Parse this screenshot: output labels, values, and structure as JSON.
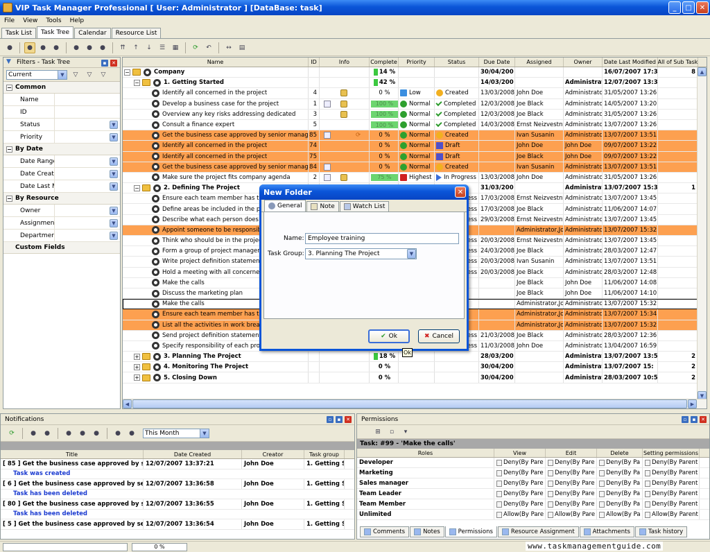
{
  "window": {
    "title": "VIP Task Manager Professional [ User: Administrator ] [DataBase: task]",
    "min": "_",
    "max": "□",
    "close": "✕"
  },
  "menu": [
    "File",
    "View",
    "Tools",
    "Help"
  ],
  "tabs": [
    "Task List",
    "Task Tree",
    "Calendar",
    "Resource List"
  ],
  "active_tab": "Task Tree",
  "filters": {
    "title": "Filters - Task Tree",
    "current": "Current",
    "sections": [
      {
        "name": "Common",
        "items": [
          "Name",
          "ID",
          "Status",
          "Priority"
        ]
      },
      {
        "name": "By Date",
        "items": [
          "Date Range",
          "Date Create",
          "Date Last Mo"
        ]
      },
      {
        "name": "By Resource",
        "items": [
          "Owner",
          "Assignment",
          "Department"
        ]
      },
      {
        "name": "Custom Fields",
        "items": []
      }
    ]
  },
  "grid": {
    "columns": [
      "Name",
      "ID",
      "Info",
      "Complete",
      "Priority",
      "Status",
      "Due Date",
      "Assigned",
      "Owner",
      "Date Last Modified",
      "All of Sub Task"
    ],
    "rows": [
      {
        "name": "Company",
        "id": "",
        "complete": "14 %",
        "pct": 0.14,
        "bar": true,
        "priority": "",
        "pkind": "",
        "status": "",
        "skind": "",
        "due": "30/04/200",
        "assigned": "",
        "owner": "",
        "modified": "16/07/2007 17:3",
        "sub": "8",
        "level": 0,
        "type": "group",
        "bold": true,
        "orange": false,
        "exp": "−"
      },
      {
        "name": "1. Getting Started",
        "id": "",
        "complete": "42 %",
        "pct": 0.42,
        "bar": true,
        "priority": "",
        "pkind": "",
        "status": "",
        "skind": "",
        "due": "14/03/200",
        "assigned": "",
        "owner": "Administrator",
        "modified": "12/07/2007 13:3",
        "sub": "",
        "level": 1,
        "type": "group",
        "bold": true,
        "orange": false,
        "exp": "−"
      },
      {
        "name": "Identify all concerned in the project",
        "id": "4",
        "complete": "0 %",
        "pct": 0,
        "bar": false,
        "priority": "Low",
        "pkind": "low",
        "status": "Created",
        "skind": "created",
        "due": "13/03/2008",
        "assigned": "John Doe",
        "owner": "Administrator",
        "modified": "31/05/2007 13:26",
        "sub": "",
        "level": 2,
        "type": "task",
        "bold": false,
        "orange": false,
        "lock": true
      },
      {
        "name": "Develop a business case for the project",
        "id": "1",
        "complete": "100 %",
        "pct": 1,
        "bar": true,
        "priority": "Normal",
        "pkind": "normal",
        "status": "Completed",
        "skind": "completed",
        "due": "12/03/2008",
        "assigned": "Joe Black",
        "owner": "Administrator",
        "modified": "14/05/2007 13:20",
        "sub": "",
        "level": 2,
        "type": "task",
        "bold": false,
        "orange": false,
        "lock": true,
        "attach": true
      },
      {
        "name": "Overview any key risks addressing dedicated",
        "id": "3",
        "complete": "100 %",
        "pct": 1,
        "bar": true,
        "priority": "Normal",
        "pkind": "normal",
        "status": "Completed",
        "skind": "completed",
        "due": "12/03/2008",
        "assigned": "Joe Black",
        "owner": "Administrator",
        "modified": "31/05/2007 13:26",
        "sub": "",
        "level": 2,
        "type": "task",
        "bold": false,
        "orange": false,
        "lock": true
      },
      {
        "name": "Consult a finance expert",
        "id": "5",
        "complete": "100 %",
        "pct": 1,
        "bar": true,
        "priority": "Normal",
        "pkind": "normal",
        "status": "Completed",
        "skind": "completed",
        "due": "14/03/2008",
        "assigned": "Ernst Neizvestny",
        "owner": "Administrator",
        "modified": "13/07/2007 13:26",
        "sub": "",
        "level": 2,
        "type": "task",
        "bold": false,
        "orange": false
      },
      {
        "name": "Get the business case approved by senior managers",
        "id": "85",
        "complete": "0 %",
        "pct": 0,
        "bar": false,
        "priority": "Normal",
        "pkind": "normal",
        "status": "Created",
        "skind": "created",
        "due": "",
        "assigned": "Ivan Susanin",
        "owner": "Administrator",
        "modified": "13/07/2007 13:51",
        "sub": "",
        "level": 2,
        "type": "task",
        "bold": false,
        "orange": true,
        "attach": true,
        "recur": true
      },
      {
        "name": "Identify all concerned in the project",
        "id": "74",
        "complete": "0 %",
        "pct": 0,
        "bar": false,
        "priority": "Normal",
        "pkind": "normal",
        "status": "Draft",
        "skind": "draft",
        "due": "",
        "assigned": "John Doe",
        "owner": "John Doe",
        "modified": "09/07/2007 13:22",
        "sub": "",
        "level": 2,
        "type": "task",
        "bold": false,
        "orange": true
      },
      {
        "name": "Identify all concerned in the project",
        "id": "75",
        "complete": "0 %",
        "pct": 0,
        "bar": false,
        "priority": "Normal",
        "pkind": "normal",
        "status": "Draft",
        "skind": "draft",
        "due": "",
        "assigned": "Joe Black",
        "owner": "John Doe",
        "modified": "09/07/2007 13:22",
        "sub": "",
        "level": 2,
        "type": "task",
        "bold": false,
        "orange": true
      },
      {
        "name": "Get the business case approved by senior managers",
        "id": "84",
        "complete": "0 %",
        "pct": 0,
        "bar": false,
        "priority": "Normal",
        "pkind": "normal",
        "status": "Created",
        "skind": "created",
        "due": "",
        "assigned": "Ivan Susanin",
        "owner": "Administrator",
        "modified": "13/07/2007 13:51",
        "sub": "",
        "level": 2,
        "type": "task",
        "bold": false,
        "orange": true,
        "attach": true
      },
      {
        "name": "Make sure the project fits company agenda",
        "id": "2",
        "complete": "75 %",
        "pct": 0.75,
        "bar": true,
        "priority": "Highest",
        "pkind": "high",
        "status": "In Progress",
        "skind": "progress",
        "due": "13/03/2008",
        "assigned": "John Doe",
        "owner": "Administrator",
        "modified": "31/05/2007 13:26",
        "sub": "",
        "level": 2,
        "type": "task",
        "bold": false,
        "orange": false,
        "lock": true,
        "attach": true
      },
      {
        "name": "2. Defining The Project",
        "id": "",
        "complete": "",
        "pct": 0,
        "bar": false,
        "priority": "",
        "pkind": "",
        "status": "",
        "skind": "",
        "due": "31/03/200",
        "assigned": "",
        "owner": "Administrator",
        "modified": "13/07/2007 15:3",
        "sub": "1",
        "level": 1,
        "type": "group",
        "bold": true,
        "orange": false,
        "exp": "−"
      },
      {
        "name": "Ensure each team member has the",
        "id": "",
        "complete": "",
        "pct": 0,
        "bar": false,
        "priority": "",
        "pkind": "",
        "status": "ess",
        "skind": "",
        "due": "17/03/2008",
        "assigned": "Ernst Neizvestny",
        "owner": "Administrator",
        "modified": "13/07/2007 13:45",
        "sub": "",
        "level": 2,
        "type": "task",
        "bold": false,
        "orange": false
      },
      {
        "name": "Define areas be included in the proj",
        "id": "",
        "complete": "",
        "pct": 0,
        "bar": false,
        "priority": "",
        "pkind": "",
        "status": "ess",
        "skind": "",
        "due": "17/03/2008",
        "assigned": "Joe Black",
        "owner": "Administrator",
        "modified": "11/06/2007 14:07",
        "sub": "",
        "level": 2,
        "type": "task",
        "bold": false,
        "orange": false
      },
      {
        "name": "Describe what each person does in",
        "id": "",
        "complete": "",
        "pct": 0,
        "bar": false,
        "priority": "",
        "pkind": "",
        "status": "ess",
        "skind": "",
        "due": "29/03/2008",
        "assigned": "Ernst Neizvestny",
        "owner": "Administrator",
        "modified": "13/07/2007 13:45",
        "sub": "",
        "level": 2,
        "type": "task",
        "bold": false,
        "orange": false
      },
      {
        "name": "Appoint someone to be responsible",
        "id": "",
        "complete": "",
        "pct": 0,
        "bar": false,
        "priority": "",
        "pkind": "",
        "status": "",
        "skind": "",
        "due": "",
        "assigned": "Administrator,Joh",
        "owner": "Administrator",
        "modified": "13/07/2007 15:32",
        "sub": "",
        "level": 2,
        "type": "task",
        "bold": false,
        "orange": true
      },
      {
        "name": "Think who should be in the project t",
        "id": "",
        "complete": "",
        "pct": 0,
        "bar": false,
        "priority": "",
        "pkind": "",
        "status": "ess",
        "skind": "",
        "due": "20/03/2008",
        "assigned": "Ernst Neizvestny",
        "owner": "Administrator",
        "modified": "13/07/2007 13:45",
        "sub": "",
        "level": 2,
        "type": "task",
        "bold": false,
        "orange": false
      },
      {
        "name": "Form a group of project managers",
        "id": "",
        "complete": "",
        "pct": 0,
        "bar": false,
        "priority": "",
        "pkind": "",
        "status": "ess",
        "skind": "",
        "due": "24/03/2008",
        "assigned": "Joe Black",
        "owner": "Administrator",
        "modified": "28/03/2007 12:47",
        "sub": "",
        "level": 2,
        "type": "task",
        "bold": false,
        "orange": false
      },
      {
        "name": "Write project definition statement",
        "id": "",
        "complete": "",
        "pct": 0,
        "bar": false,
        "priority": "",
        "pkind": "",
        "status": "ess",
        "skind": "",
        "due": "20/03/2008",
        "assigned": "Ivan Susanin",
        "owner": "Administrator",
        "modified": "13/07/2007 13:51",
        "sub": "",
        "level": 2,
        "type": "task",
        "bold": false,
        "orange": false
      },
      {
        "name": "Hold a meeting with all concerned",
        "id": "",
        "complete": "",
        "pct": 0,
        "bar": false,
        "priority": "",
        "pkind": "",
        "status": "ess",
        "skind": "",
        "due": "20/03/2008",
        "assigned": "Joe Black",
        "owner": "Administrator",
        "modified": "28/03/2007 12:48",
        "sub": "",
        "level": 2,
        "type": "task",
        "bold": false,
        "orange": false
      },
      {
        "name": "Make the calls",
        "id": "",
        "complete": "",
        "pct": 0,
        "bar": false,
        "priority": "",
        "pkind": "",
        "status": "",
        "skind": "",
        "due": "",
        "assigned": "Joe Black",
        "owner": "John Doe",
        "modified": "11/06/2007 14:08",
        "sub": "",
        "level": 2,
        "type": "task",
        "bold": false,
        "orange": false
      },
      {
        "name": "Discuss the marketing plan",
        "id": "",
        "complete": "",
        "pct": 0,
        "bar": false,
        "priority": "",
        "pkind": "",
        "status": "",
        "skind": "",
        "due": "",
        "assigned": "Joe Black",
        "owner": "John Doe",
        "modified": "11/06/2007 14:10",
        "sub": "",
        "level": 2,
        "type": "task",
        "bold": false,
        "orange": false
      },
      {
        "name": "Make the calls",
        "id": "",
        "complete": "",
        "pct": 0,
        "bar": false,
        "priority": "",
        "pkind": "",
        "status": "",
        "skind": "",
        "due": "",
        "assigned": "Administrator,Joh",
        "owner": "Administrator",
        "modified": "13/07/2007 15:32",
        "sub": "",
        "level": 2,
        "type": "task",
        "bold": false,
        "orange": false,
        "selected": true
      },
      {
        "name": "Ensure each team member has the",
        "id": "",
        "complete": "",
        "pct": 0,
        "bar": false,
        "priority": "",
        "pkind": "",
        "status": "",
        "skind": "",
        "due": "",
        "assigned": "Administrator,Joe",
        "owner": "Administrator",
        "modified": "13/07/2007 15:34",
        "sub": "",
        "level": 2,
        "type": "task",
        "bold": false,
        "orange": true
      },
      {
        "name": "List all the activities in work breakdo",
        "id": "",
        "complete": "",
        "pct": 0,
        "bar": false,
        "priority": "",
        "pkind": "",
        "status": "",
        "skind": "",
        "due": "",
        "assigned": "Administrator,Joe",
        "owner": "Administrator",
        "modified": "13/07/2007 15:32",
        "sub": "",
        "level": 2,
        "type": "task",
        "bold": false,
        "orange": true
      },
      {
        "name": "Send project definition statement to",
        "id": "",
        "complete": "",
        "pct": 0,
        "bar": false,
        "priority": "",
        "pkind": "",
        "status": "ess",
        "skind": "",
        "due": "21/03/2008",
        "assigned": "Joe Black",
        "owner": "Administrator",
        "modified": "28/03/2007 12:36",
        "sub": "",
        "level": 2,
        "type": "task",
        "bold": false,
        "orange": false
      },
      {
        "name": "Specify responsibility of each projec",
        "id": "",
        "complete": "",
        "pct": 0,
        "bar": false,
        "priority": "",
        "pkind": "",
        "status": "ess",
        "skind": "",
        "due": "11/03/2008",
        "assigned": "John Doe",
        "owner": "Administrator",
        "modified": "13/04/2007 16:59",
        "sub": "",
        "level": 2,
        "type": "task",
        "bold": false,
        "orange": false
      },
      {
        "name": "3. Planning The Project",
        "id": "",
        "complete": "18 %",
        "pct": 0.18,
        "bar": true,
        "priority": "",
        "pkind": "",
        "status": "",
        "skind": "",
        "due": "28/03/200",
        "assigned": "",
        "owner": "Administrator",
        "modified": "13/07/2007 13:5",
        "sub": "2",
        "level": 1,
        "type": "group",
        "bold": true,
        "orange": false,
        "exp": "+"
      },
      {
        "name": "4. Monitoring The Project",
        "id": "",
        "complete": "0 %",
        "pct": 0,
        "bar": false,
        "priority": "",
        "pkind": "",
        "status": "",
        "skind": "",
        "due": "30/04/200",
        "assigned": "",
        "owner": "Administrator",
        "modified": "13/07/2007 15:",
        "sub": "2",
        "level": 1,
        "type": "group",
        "bold": true,
        "orange": false,
        "exp": "+"
      },
      {
        "name": "5. Closing Down",
        "id": "",
        "complete": "0 %",
        "pct": 0,
        "bar": false,
        "priority": "",
        "pkind": "",
        "status": "",
        "skind": "",
        "due": "30/04/200",
        "assigned": "",
        "owner": "Administrator",
        "modified": "28/03/2007 10:5",
        "sub": "2",
        "level": 1,
        "type": "group",
        "bold": true,
        "orange": false,
        "exp": "+"
      }
    ]
  },
  "dialog": {
    "title": "New Folder",
    "tabs": [
      "General",
      "Note",
      "Watch List"
    ],
    "name_label": "Name:",
    "name_value": "Employee training",
    "group_label": "Task Group:",
    "group_value": "3. Planning The Project",
    "ok": "Ok",
    "cancel": "Cancel",
    "tooltip": "Ok"
  },
  "notifications": {
    "title": "Notifications",
    "period": "This Month",
    "columns": [
      "Title",
      "Date Created",
      "Creator",
      "Task group"
    ],
    "rows": [
      {
        "title": "[ 85 ] Get the business case approved by sen",
        "date": "12/07/2007 13:37:21",
        "creator": "John Doe",
        "group": "1. Getting St",
        "note": "Task was created"
      },
      {
        "title": "[ 6 ] Get the business case approved by seni",
        "date": "12/07/2007 13:36:58",
        "creator": "John Doe",
        "group": "1. Getting St",
        "note": "Task has been deleted"
      },
      {
        "title": "[ 80 ] Get the business case approved by sen",
        "date": "12/07/2007 13:36:55",
        "creator": "John Doe",
        "group": "1. Getting St",
        "note": "Task has been deleted"
      },
      {
        "title": "[ 5 ] Get the business case approved by seni",
        "date": "12/07/2007 13:36:54",
        "creator": "John Doe",
        "group": "1. Getting St",
        "note": ""
      }
    ]
  },
  "permissions": {
    "title": "Permissions",
    "task": "Task: #99 - 'Make the calls'",
    "columns": [
      "Roles",
      "View",
      "Edit",
      "Delete",
      "Setting permissions"
    ],
    "rows": [
      {
        "role": "Developer",
        "v": "Deny(By Pare",
        "e": "Deny(By Pare",
        "d": "Deny(By Pa",
        "s": "Deny(By Parent"
      },
      {
        "role": "Marketing",
        "v": "Deny(By Pare",
        "e": "Deny(By Pare",
        "d": "Deny(By Pa",
        "s": "Deny(By Parent"
      },
      {
        "role": "Sales manager",
        "v": "Deny(By Pare",
        "e": "Deny(By Pare",
        "d": "Deny(By Pa",
        "s": "Deny(By Parent"
      },
      {
        "role": "Team Leader",
        "v": "Deny(By Pare",
        "e": "Deny(By Pare",
        "d": "Deny(By Pa",
        "s": "Deny(By Parent"
      },
      {
        "role": "Team Member",
        "v": "Deny(By Pare",
        "e": "Deny(By Pare",
        "d": "Deny(By Pa",
        "s": "Deny(By Parent"
      },
      {
        "role": "Unlimited",
        "v": "Allow(By Pare",
        "e": "Allow(By Pare",
        "d": "Allow(By Pa",
        "s": "Allow(By Parent"
      }
    ],
    "tabs": [
      "Comments",
      "Notes",
      "Permissions",
      "Resource Assignment",
      "Attachments",
      "Task history"
    ],
    "active_tab": "Permissions"
  },
  "status": {
    "progress": "0 %"
  },
  "watermark": "www.taskmanagementguide.com"
}
